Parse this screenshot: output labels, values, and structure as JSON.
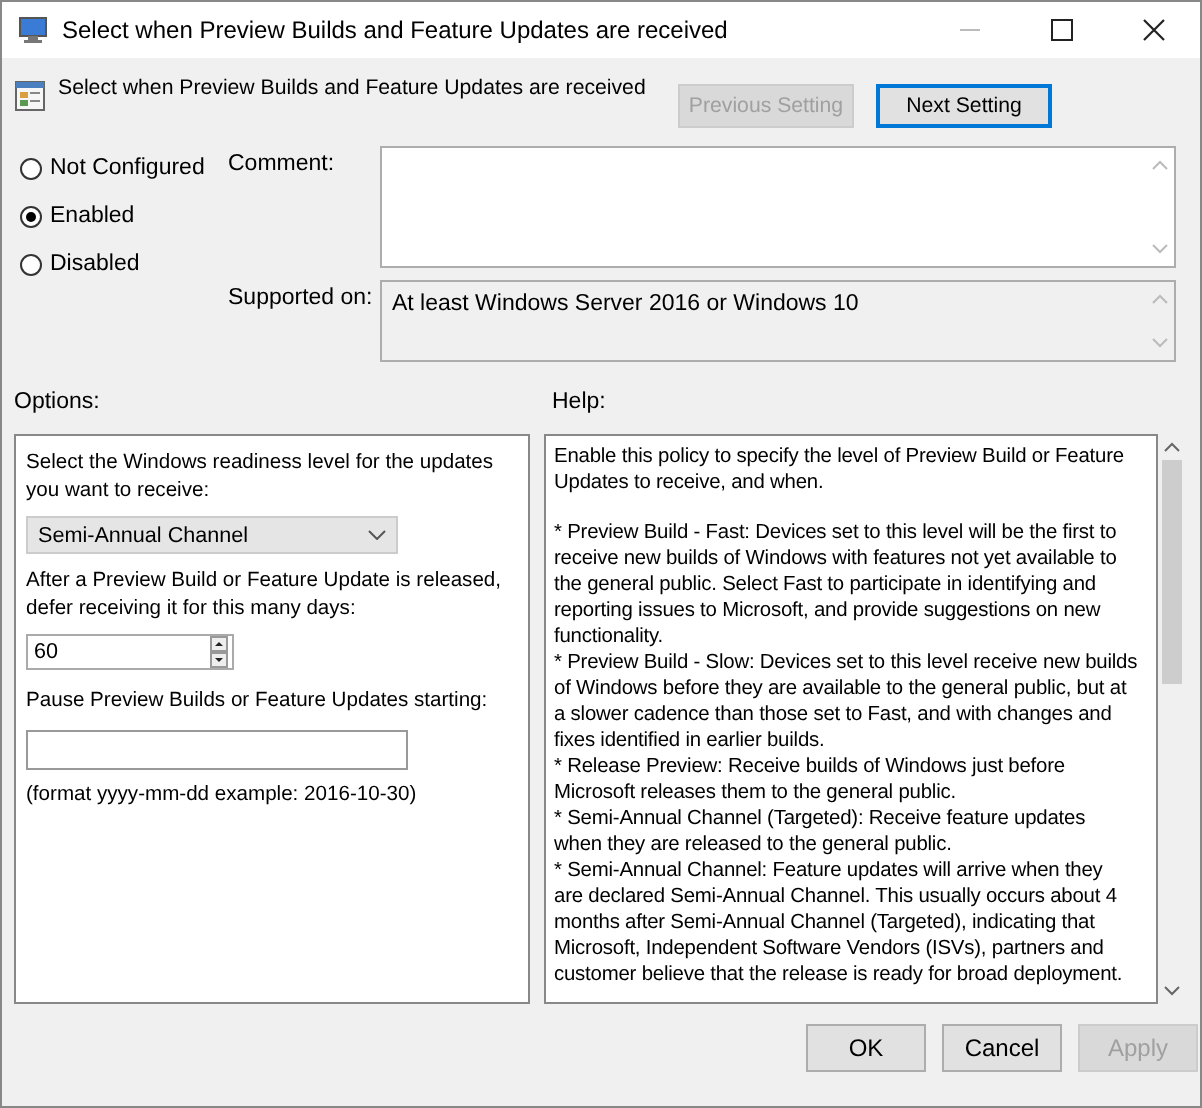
{
  "window": {
    "title": "Select when Preview Builds and Feature Updates are received"
  },
  "header": {
    "title": "Select when Preview Builds and Feature Updates are received",
    "buttons": [
      {
        "label": "Previous Setting",
        "disabled": true,
        "focused": false
      },
      {
        "label": "Next Setting",
        "disabled": false,
        "focused": true
      }
    ]
  },
  "state_options": [
    {
      "label": "Not Configured",
      "selected": false
    },
    {
      "label": "Enabled",
      "selected": true
    },
    {
      "label": "Disabled",
      "selected": false
    }
  ],
  "comment": {
    "label": "Comment:"
  },
  "supported_on": {
    "label": "Supported on:",
    "value": "At least Windows Server 2016 or Windows 10"
  },
  "options": {
    "label": "Options:",
    "readiness_label": "Select the Windows readiness level for the updates you want to receive:",
    "readiness_value": "Semi-Annual Channel",
    "defer_label": "After a Preview Build or Feature Update is released, defer receiving it for this many days:",
    "defer_value": "60",
    "pause_label": "Pause Preview Builds or Feature Updates starting:",
    "format_hint": "(format yyyy-mm-dd example: 2016-10-30)"
  },
  "help": {
    "label": "Help:",
    "paragraphs": [
      [
        "Enable this policy to specify the level of Preview Build or Feature",
        "Updates to receive, and when."
      ],
      [
        "* Preview Build - Fast: Devices set to this level will be the first to",
        "receive new builds of Windows with features not yet available to",
        "the general public. Select Fast to participate in identifying and",
        "reporting issues to Microsoft, and provide suggestions on new",
        "functionality.",
        "* Preview Build - Slow: Devices set to this level receive new builds",
        "of Windows before they are available to the general public, but at",
        "a slower cadence than those set to Fast, and with changes and",
        "fixes identified in earlier builds.",
        "* Release Preview: Receive builds of Windows just before",
        "Microsoft releases them to the general public.",
        "* Semi-Annual Channel (Targeted): Receive feature updates",
        "when they are released to the general public.",
        "* Semi-Annual Channel: Feature updates will arrive when they",
        "are declared Semi-Annual Channel. This usually occurs about 4",
        "months after Semi-Annual Channel (Targeted), indicating that",
        "Microsoft, Independent Software Vendors (ISVs), partners and",
        "customer believe that the release is ready for broad deployment."
      ]
    ]
  },
  "footer_buttons": [
    {
      "label": "OK",
      "disabled": false
    },
    {
      "label": "Cancel",
      "disabled": false
    },
    {
      "label": "Apply",
      "disabled": true
    }
  ]
}
